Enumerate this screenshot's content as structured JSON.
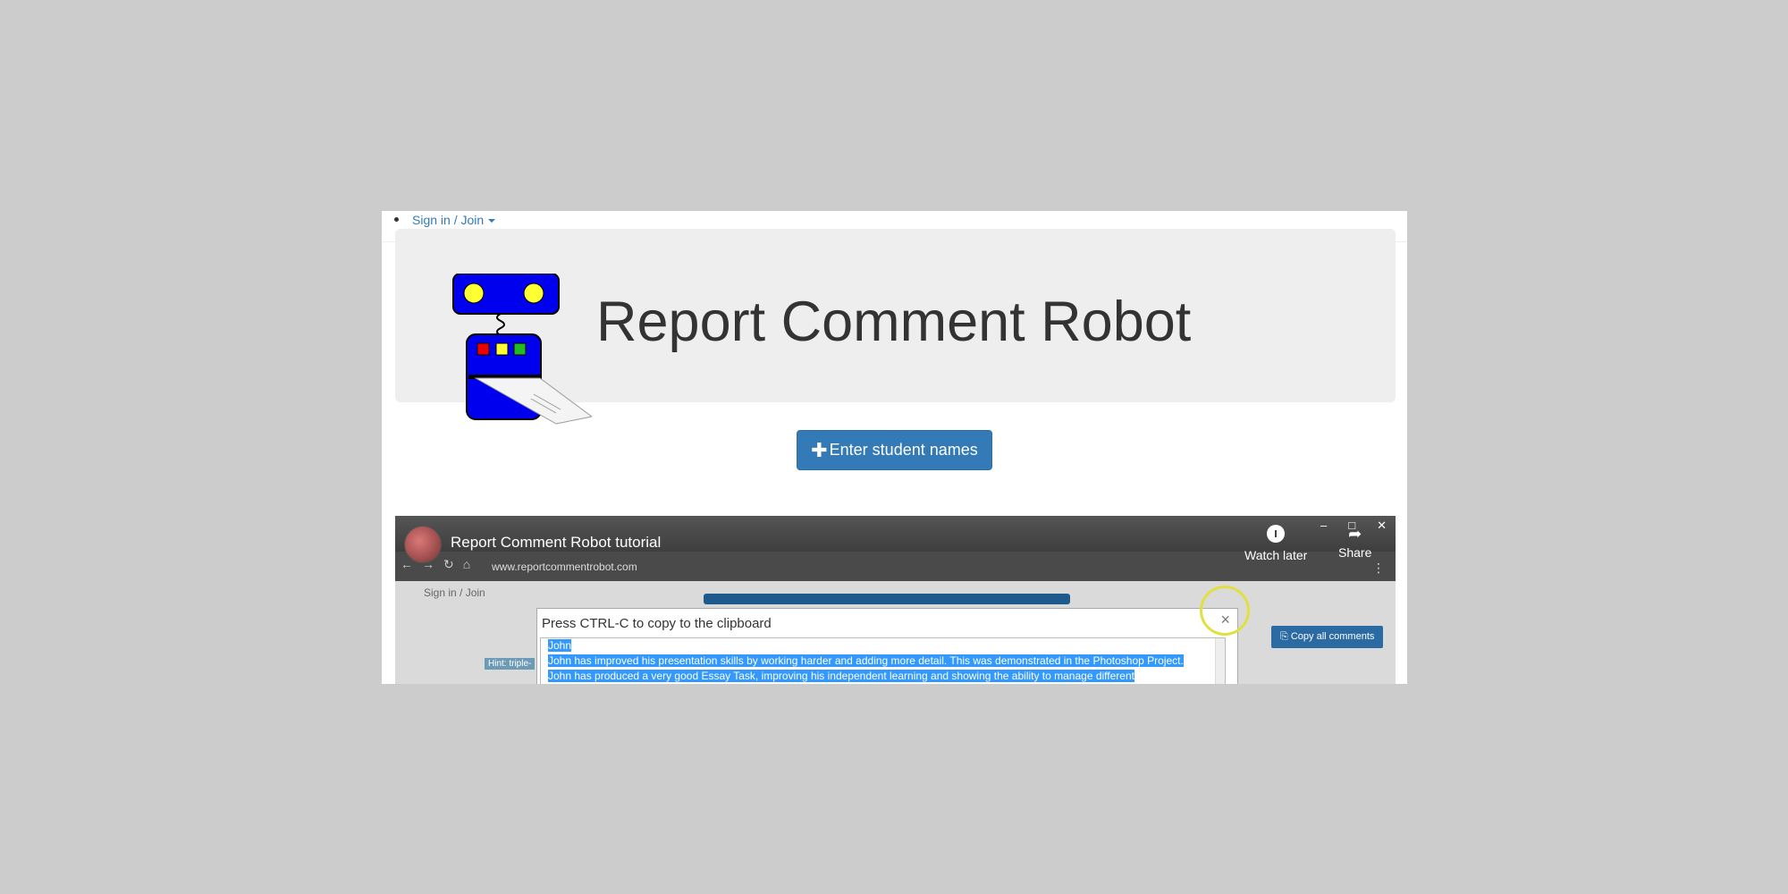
{
  "nav": {
    "signin_label": "Sign in / Join"
  },
  "header": {
    "title": "Report Comment Robot"
  },
  "actions": {
    "enter_students_label": "Enter student names"
  },
  "video": {
    "title": "Report Comment Robot tutorial",
    "watch_later_label": "Watch later",
    "share_label": "Share",
    "url": "www.reportcommentrobot.com",
    "inner_signin": "Sign in / Join",
    "copy_all_label": "Copy all comments",
    "hint_label": "Hint: triple-",
    "dialog": {
      "title": "Press CTRL-C to copy to the clipboard",
      "lines": [
        "John",
        "John has improved his presentation skills by working harder and adding more detail. This was demonstrated in the Photoshop Project.",
        "John has produced a very good Essay Task, improving his independent learning and showing the ability to manage different"
      ]
    }
  },
  "colors": {
    "background": "#cccccc",
    "jumbotron": "#eeeeee",
    "primary": "#337ab7",
    "robot_blue": "#0000ee"
  }
}
